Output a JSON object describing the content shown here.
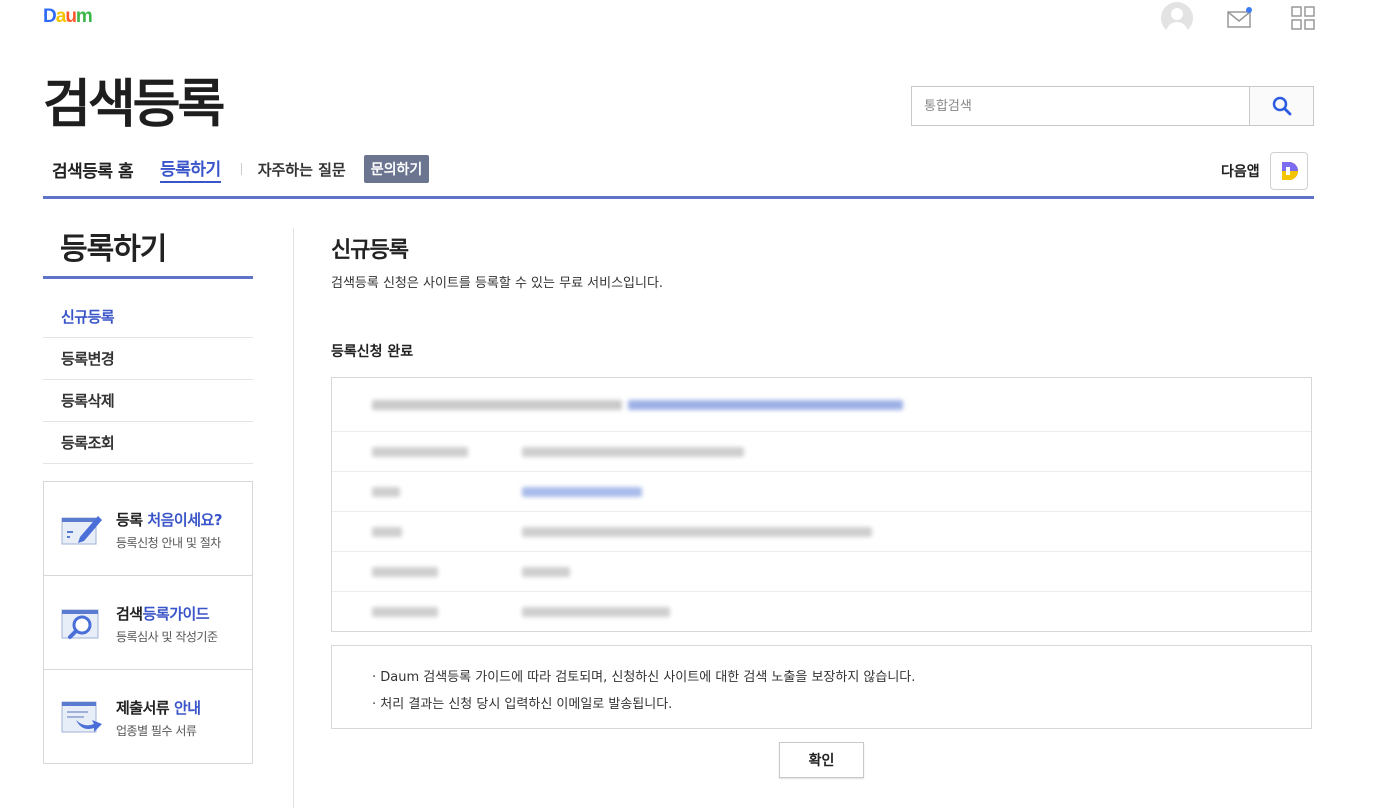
{
  "header": {
    "logo_letters": [
      "D",
      "a",
      "u",
      "m"
    ],
    "logo_colors": [
      "#2f6cf6",
      "#f5c400",
      "#ff5a2d",
      "#3cb649"
    ],
    "page_title": "검색등록"
  },
  "search": {
    "placeholder": "통합검색",
    "value": ""
  },
  "gnb": {
    "home": "검색등록 홈",
    "register": "등록하기",
    "faq": "자주하는 질문",
    "inquiry": "문의하기"
  },
  "app": {
    "label": "다음앱"
  },
  "lnb": {
    "title": "등록하기",
    "items": [
      {
        "label": "신규등록",
        "active": true
      },
      {
        "label": "등록변경",
        "active": false
      },
      {
        "label": "등록삭제",
        "active": false
      },
      {
        "label": "등록조회",
        "active": false
      }
    ],
    "banners": [
      {
        "title_plain": "등록 ",
        "title_em": "처음이세요?",
        "sub": "등록신청 안내 및 절차",
        "icon": "pen-note-icon"
      },
      {
        "title_plain": "검색",
        "title_em": "등록가이드",
        "sub": "등록심사 및 작성기준",
        "icon": "magnifier-guide-icon"
      },
      {
        "title_plain": "제출서류 ",
        "title_em": "안내",
        "sub": "업종별 필수 서류",
        "icon": "document-arrow-icon"
      }
    ]
  },
  "content": {
    "title": "신규등록",
    "desc": "검색등록 신청은 사이트를 등록할 수 있는 무료 서비스입니다.",
    "section_title": "등록신청 완료",
    "notices": [
      "· Daum 검색등록 가이드에 따라 검토되며, 신청하신 사이트에 대한 검색 노출을 보장하지 않습니다.",
      "· 처리 결과는 신청 당시 입력하신 이메일로 발송됩니다."
    ],
    "confirm_label": "확인"
  },
  "colors": {
    "accent": "#3a55c9",
    "line": "#5f73c9",
    "inquiry_bg": "#6b7590"
  }
}
